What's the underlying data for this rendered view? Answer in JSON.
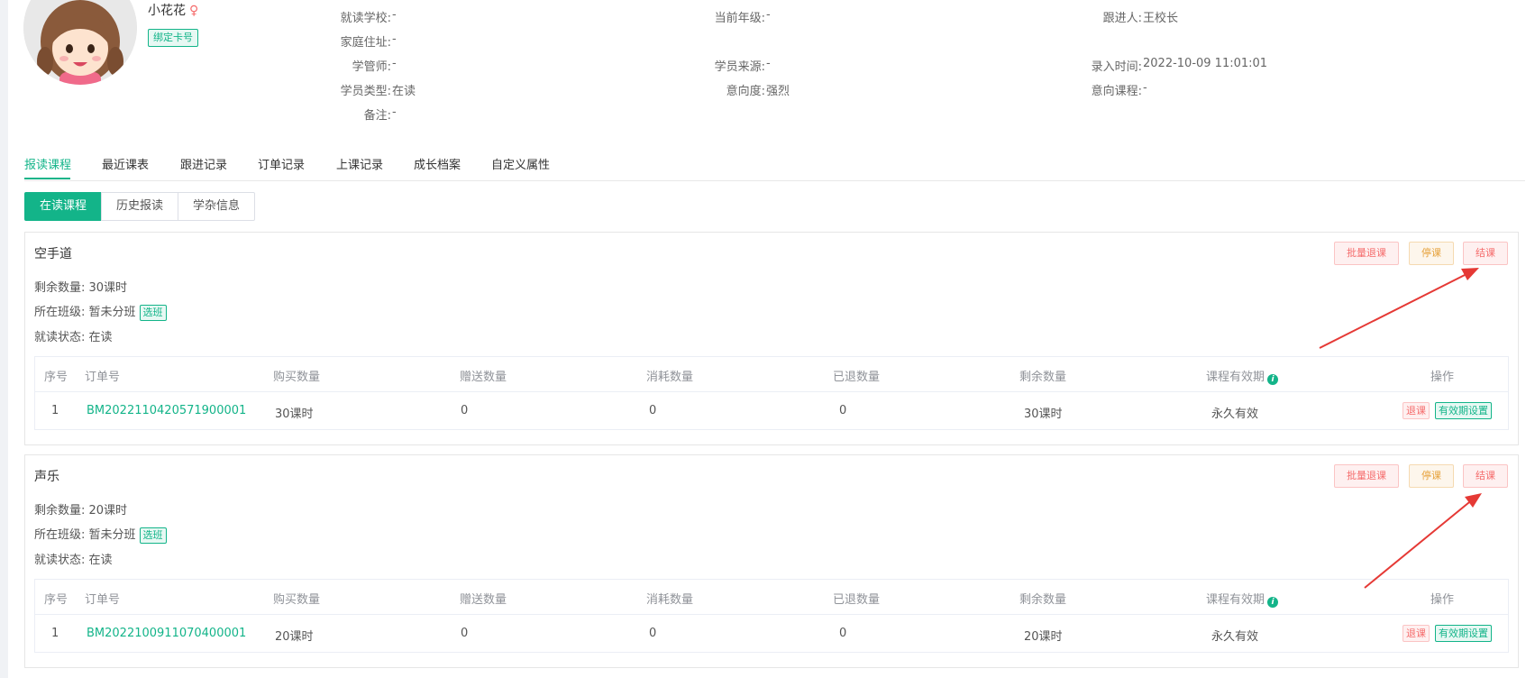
{
  "student": {
    "name": "小花花",
    "gender_symbol": "♀",
    "bind_card_label": "绑定卡号"
  },
  "info": {
    "school_label": "就读学校:",
    "school_value": "-",
    "grade_label": "当前年级:",
    "grade_value": "-",
    "follower_label": "跟进人:",
    "follower_value": "王校长",
    "address_label": "家庭住址:",
    "address_value": "-",
    "manager_label": "学管师:",
    "manager_value": "-",
    "source_label": "学员来源:",
    "source_value": "-",
    "entry_label": "录入时间:",
    "entry_value": "2022-10-09 11:01:01",
    "type_label": "学员类型:",
    "type_value": "在读",
    "intent_label": "意向度:",
    "intent_value": "强烈",
    "intent_course_label": "意向课程:",
    "intent_course_value": "-",
    "remark_label": "备注:",
    "remark_value": "-"
  },
  "tabs": [
    "报读课程",
    "最近课表",
    "跟进记录",
    "订单记录",
    "上课记录",
    "成长档案",
    "自定义属性"
  ],
  "segments": [
    "在读课程",
    "历史报读",
    "学杂信息"
  ],
  "actions": {
    "batch_refund": "批量退课",
    "stop": "停课",
    "end": "结课"
  },
  "select_class_label": "选班",
  "table_headers": [
    "序号",
    "订单号",
    "购买数量",
    "赠送数量",
    "消耗数量",
    "已退数量",
    "剩余数量",
    "课程有效期",
    "操作"
  ],
  "row_actions": {
    "refund": "退课",
    "validity": "有效期设置"
  },
  "courses": [
    {
      "title": "空手道",
      "remaining": "剩余数量: 30课时",
      "class_prefix": "所在班级: 暂未分班",
      "status": "就读状态: 在读",
      "row": {
        "index": "1",
        "order_no": "BM2022110420571900001",
        "bought": "30课时",
        "gift": "0",
        "consumed": "0",
        "returned": "0",
        "remain": "30课时",
        "validity": "永久有效"
      }
    },
    {
      "title": "声乐",
      "remaining": "剩余数量: 20课时",
      "class_prefix": "所在班级: 暂未分班",
      "status": "就读状态: 在读",
      "row": {
        "index": "1",
        "order_no": "BM2022100911070400001",
        "bought": "20课时",
        "gift": "0",
        "consumed": "0",
        "returned": "0",
        "remain": "20课时",
        "validity": "永久有效"
      }
    }
  ],
  "colors": {
    "accent": "#13b489",
    "danger": "#f56c6c",
    "warning": "#e6a23c",
    "arrow": "#e53935"
  }
}
